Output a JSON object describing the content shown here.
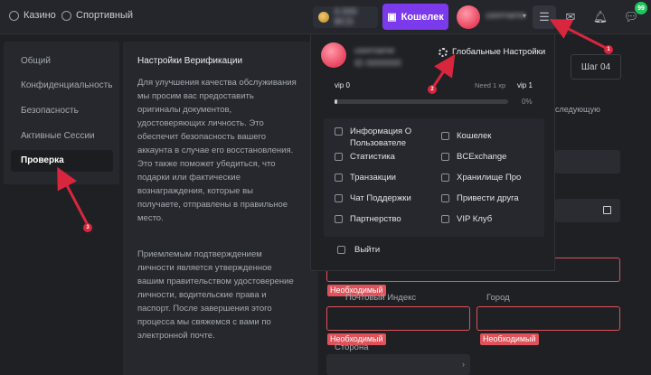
{
  "topbar": {
    "casino_label": "Казино",
    "sport_label": "Спортивный",
    "balance_blurred": "0.000 BCD",
    "wallet_label": "Кошелек",
    "username_blurred": "username",
    "chat_badge": "99"
  },
  "settings_nav": {
    "items": [
      "Общий",
      "Конфиденциальность",
      "Безопасность",
      "Активные Сессии"
    ],
    "active": "Проверка"
  },
  "info_panel": {
    "title": "Настройки Верификации",
    "paragraph1": "Для улучшения качества обслуживания мы просим вас предоставить оригиналы документов, удостоверяющих личность. Это обеспечит безопасность вашего аккаунта в случае его восстановления. Это также поможет убедиться, что подарки или фактические вознаграждения, которые вы получаете, отправлены в правильное место.",
    "paragraph2": "Приемлемым подтверждением личности является утвержденное вашим правительством удостоверение личности, водительские права и паспорт. После завершения этого процесса мы свяжемся с вами по электронной почте."
  },
  "form": {
    "step_tab": "Шаг 04",
    "fragment_text": "следующую",
    "required_label": "Необходимый",
    "postal_code_label": "Почтовый Индекс",
    "city_label": "Город",
    "country_label": "Сторона"
  },
  "dropdown": {
    "username_blurred": "username",
    "userid_blurred": "ID 0000000",
    "global_settings": "Глобальные Настройки",
    "vip_from": "vip 0",
    "vip_to": "vip 1",
    "need_xp": "Need 1 xp",
    "progress_percent": "0%",
    "progress_fraction": 0.0,
    "menu_items_left": [
      "Информация О Пользователе",
      "Статистика",
      "Транзакции",
      "Чат Поддержки",
      "Партнерство"
    ],
    "menu_items_right": [
      "Кошелек",
      "BCExchange",
      "Хранилище Про",
      "Привести друга",
      "VIP Клуб"
    ],
    "logout": "Выйти"
  },
  "annotations": [
    "1",
    "2",
    "3"
  ],
  "colors": {
    "accent": "#7c3aed",
    "error": "#e0525a",
    "annotation": "#d7263d",
    "badge": "#22c55e"
  }
}
